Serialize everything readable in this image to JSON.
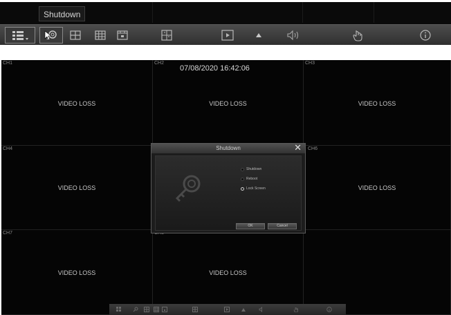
{
  "tooltip": "Shutdown",
  "toolbar": {
    "buttons": [
      {
        "name": "layout-menu",
        "icon": "grid-layout-icon"
      },
      {
        "name": "shutdown",
        "icon": "key-icon"
      },
      {
        "name": "view-4",
        "icon": "quad-grid-icon"
      },
      {
        "name": "view-9",
        "icon": "nine-grid-icon"
      },
      {
        "name": "view-pip",
        "icon": "pip-icon"
      },
      {
        "name": "view-custom",
        "icon": "custom-grid-icon"
      },
      {
        "name": "playback",
        "icon": "play-icon"
      },
      {
        "name": "more",
        "icon": "up-arrow-icon"
      },
      {
        "name": "volume",
        "icon": "speaker-icon"
      },
      {
        "name": "manual",
        "icon": "hand-icon"
      },
      {
        "name": "info",
        "icon": "info-icon"
      }
    ]
  },
  "datetime": "07/08/2020 16:42:06",
  "channels": [
    {
      "label": "CH1",
      "status": "VIDEO LOSS"
    },
    {
      "label": "CH2",
      "status": "VIDEO LOSS"
    },
    {
      "label": "CH3",
      "status": "VIDEO LOSS"
    },
    {
      "label": "CH4",
      "status": "VIDEO LOSS"
    },
    {
      "label": "",
      "status": ""
    },
    {
      "label": "CH6",
      "status": "VIDEO LOSS"
    },
    {
      "label": "CH7",
      "status": "VIDEO LOSS"
    },
    {
      "label": "CH8",
      "status": "VIDEO LOSS"
    },
    {
      "label": "",
      "status": ""
    }
  ],
  "dialog": {
    "title": "Shutdown",
    "options": [
      "Shutdown",
      "Reboot",
      "Lock Screen"
    ],
    "selected": "Lock Screen",
    "ok_label": "OK",
    "cancel_label": "Cancel",
    "close_symbol": "✕"
  },
  "colors": {
    "background": "#050505",
    "toolbar": "#3c3c3c",
    "text": "#c8c8c8"
  }
}
